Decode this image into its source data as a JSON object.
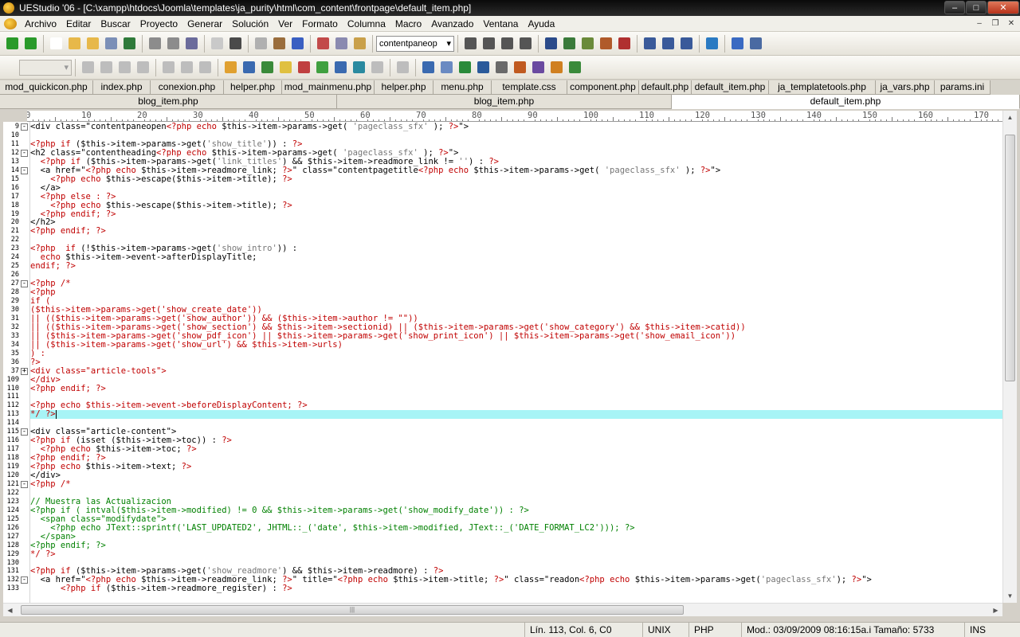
{
  "window": {
    "title": "UEStudio '06 - [C:\\xampp\\htdocs\\Joomla\\templates\\ja_purity\\html\\com_content\\frontpage\\default_item.php]"
  },
  "menu": [
    "Archivo",
    "Editar",
    "Buscar",
    "Proyecto",
    "Generar",
    "Solución",
    "Ver",
    "Formato",
    "Columna",
    "Macro",
    "Avanzado",
    "Ventana",
    "Ayuda"
  ],
  "toolbar": {
    "font_combo_value": "contentpaneop"
  },
  "tabs_row1": [
    "mod_quickicon.php",
    "index.php",
    "conexion.php",
    "helper.php",
    "mod_mainmenu.php",
    "helper.php",
    "menu.php",
    "template.css",
    "component.php",
    "default.php",
    "default_item.php",
    "ja_templatetools.php",
    "ja_vars.php",
    "params.ini"
  ],
  "tabs_row2": [
    "blog_item.php",
    "blog_item.php",
    "default_item.php"
  ],
  "ruler_labels": [
    "0",
    "10",
    "20",
    "30",
    "40",
    "50",
    "60",
    "70",
    "80",
    "90",
    "100",
    "110",
    "120",
    "130",
    "140",
    "150",
    "160",
    "170"
  ],
  "editor": {
    "lines": [
      {
        "num": "9",
        "fold": "-",
        "parts": [
          [
            "v",
            "<div class=\"contentpaneopen"
          ],
          [
            "k",
            "<?php echo "
          ],
          [
            "v",
            "$this->item->params->get( "
          ],
          [
            "s",
            "'pageclass_sfx'"
          ],
          [
            "v",
            " ); "
          ],
          [
            "k",
            "?>"
          ],
          [
            "v",
            "\">"
          ]
        ]
      },
      {
        "num": "10",
        "parts": []
      },
      {
        "num": "11",
        "parts": [
          [
            "k",
            "<?php if "
          ],
          [
            "v",
            "($this->item->params->get("
          ],
          [
            "s",
            "'show_title'"
          ],
          [
            "v",
            ")) : "
          ],
          [
            "k",
            "?>"
          ]
        ]
      },
      {
        "num": "12",
        "fold": "-",
        "parts": [
          [
            "v",
            "<h2 class=\"contentheading"
          ],
          [
            "k",
            "<?php echo "
          ],
          [
            "v",
            "$this->item->params->get( "
          ],
          [
            "s",
            "'pageclass_sfx'"
          ],
          [
            "v",
            " ); "
          ],
          [
            "k",
            "?>"
          ],
          [
            "v",
            "\">"
          ]
        ]
      },
      {
        "num": "13",
        "parts": [
          [
            "v",
            "  "
          ],
          [
            "k",
            "<?php if "
          ],
          [
            "v",
            "($this->item->params->get("
          ],
          [
            "s",
            "'link_titles'"
          ],
          [
            "v",
            ") && $this->item->readmore_link != "
          ],
          [
            "s",
            "''"
          ],
          [
            "v",
            ") : "
          ],
          [
            "k",
            "?>"
          ]
        ]
      },
      {
        "num": "14",
        "fold": "-",
        "parts": [
          [
            "v",
            "  <a href=\""
          ],
          [
            "k",
            "<?php echo "
          ],
          [
            "v",
            "$this->item->readmore_link; "
          ],
          [
            "k",
            "?>"
          ],
          [
            "v",
            "\" class=\"contentpagetitle"
          ],
          [
            "k",
            "<?php echo "
          ],
          [
            "v",
            "$this->item->params->get( "
          ],
          [
            "s",
            "'pageclass_sfx'"
          ],
          [
            "v",
            " ); "
          ],
          [
            "k",
            "?>"
          ],
          [
            "v",
            "\">"
          ]
        ]
      },
      {
        "num": "15",
        "parts": [
          [
            "v",
            "    "
          ],
          [
            "k",
            "<?php echo "
          ],
          [
            "v",
            "$this->escape($this->item->title); "
          ],
          [
            "k",
            "?>"
          ]
        ]
      },
      {
        "num": "16",
        "parts": [
          [
            "v",
            "  </a>"
          ]
        ]
      },
      {
        "num": "17",
        "parts": [
          [
            "v",
            "  "
          ],
          [
            "k",
            "<?php else : ?>"
          ]
        ]
      },
      {
        "num": "18",
        "parts": [
          [
            "v",
            "    "
          ],
          [
            "k",
            "<?php echo "
          ],
          [
            "v",
            "$this->escape($this->item->title); "
          ],
          [
            "k",
            "?>"
          ]
        ]
      },
      {
        "num": "19",
        "parts": [
          [
            "v",
            "  "
          ],
          [
            "k",
            "<?php endif; ?>"
          ]
        ]
      },
      {
        "num": "20",
        "parts": [
          [
            "v",
            "</h2>"
          ]
        ]
      },
      {
        "num": "21",
        "parts": [
          [
            "k",
            "<?php endif; ?>"
          ]
        ]
      },
      {
        "num": "22",
        "parts": []
      },
      {
        "num": "23",
        "parts": [
          [
            "k",
            "<?php  if "
          ],
          [
            "v",
            "(!$this->item->params->get("
          ],
          [
            "s",
            "'show_intro'"
          ],
          [
            "v",
            ")) :"
          ]
        ]
      },
      {
        "num": "24",
        "parts": [
          [
            "v",
            "  "
          ],
          [
            "k",
            "echo "
          ],
          [
            "v",
            "$this->item->event->afterDisplayTitle;"
          ]
        ]
      },
      {
        "num": "25",
        "parts": [
          [
            "k",
            "endif; ?>"
          ]
        ]
      },
      {
        "num": "26",
        "parts": []
      },
      {
        "num": "27",
        "fold": "-",
        "parts": [
          [
            "k",
            "<?php /*"
          ]
        ]
      },
      {
        "num": "28",
        "parts": [
          [
            "k",
            "<?php"
          ]
        ]
      },
      {
        "num": "29",
        "parts": [
          [
            "k",
            "if ("
          ]
        ]
      },
      {
        "num": "30",
        "parts": [
          [
            "k",
            "($this->item->params->get('show_create_date'))"
          ]
        ]
      },
      {
        "num": "31",
        "parts": [
          [
            "k",
            "|| (($this->item->params->get('show_author')) && ($this->item->author != \"\"))"
          ]
        ]
      },
      {
        "num": "32",
        "parts": [
          [
            "k",
            "|| (($this->item->params->get('show_section') && $this->item->sectionid) || ($this->item->params->get('show_category') && $this->item->catid))"
          ]
        ]
      },
      {
        "num": "33",
        "parts": [
          [
            "k",
            "|| ($this->item->params->get('show_pdf_icon') || $this->item->params->get('show_print_icon') || $this->item->params->get('show_email_icon'))"
          ]
        ]
      },
      {
        "num": "34",
        "parts": [
          [
            "k",
            "|| ($this->item->params->get('show_url') && $this->item->urls)"
          ]
        ]
      },
      {
        "num": "35",
        "parts": [
          [
            "k",
            ") :"
          ]
        ]
      },
      {
        "num": "36",
        "parts": [
          [
            "k",
            "?>"
          ]
        ]
      },
      {
        "num": "37",
        "fold": "+",
        "parts": [
          [
            "k",
            "<div class=\"article-tools\">"
          ]
        ]
      },
      {
        "num": "109",
        "parts": [
          [
            "k",
            "</div>"
          ]
        ]
      },
      {
        "num": "110",
        "parts": [
          [
            "k",
            "<?php endif; ?>"
          ]
        ]
      },
      {
        "num": "111",
        "parts": []
      },
      {
        "num": "112",
        "parts": [
          [
            "k",
            "<?php echo $this->item->event->beforeDisplayContent; ?>"
          ]
        ]
      },
      {
        "num": "113",
        "cur": true,
        "parts": [
          [
            "k",
            "*/ ?>"
          ]
        ]
      },
      {
        "num": "114",
        "parts": []
      },
      {
        "num": "115",
        "fold": "-",
        "parts": [
          [
            "v",
            "<div class=\"article-content\">"
          ]
        ]
      },
      {
        "num": "116",
        "parts": [
          [
            "k",
            "<?php if "
          ],
          [
            "v",
            "(isset ($this->item->toc)) : "
          ],
          [
            "k",
            "?>"
          ]
        ]
      },
      {
        "num": "117",
        "parts": [
          [
            "v",
            "  "
          ],
          [
            "k",
            "<?php echo "
          ],
          [
            "v",
            "$this->item->toc; "
          ],
          [
            "k",
            "?>"
          ]
        ]
      },
      {
        "num": "118",
        "parts": [
          [
            "k",
            "<?php endif; ?>"
          ]
        ]
      },
      {
        "num": "119",
        "parts": [
          [
            "k",
            "<?php echo "
          ],
          [
            "v",
            "$this->item->text; "
          ],
          [
            "k",
            "?>"
          ]
        ]
      },
      {
        "num": "120",
        "parts": [
          [
            "v",
            "</div>"
          ]
        ]
      },
      {
        "num": "121",
        "fold": "-",
        "parts": [
          [
            "k",
            "<?php /*"
          ]
        ]
      },
      {
        "num": "122",
        "parts": []
      },
      {
        "num": "123",
        "parts": [
          [
            "c",
            "// Muestra las Actualizacion"
          ]
        ]
      },
      {
        "num": "124",
        "parts": [
          [
            "c",
            "<?php if ( intval($this->item->modified) != 0 && $this->item->params->get('show_modify_date')) : ?>"
          ]
        ]
      },
      {
        "num": "125",
        "parts": [
          [
            "c",
            "  <span class=\"modifydate\">"
          ]
        ]
      },
      {
        "num": "126",
        "parts": [
          [
            "c",
            "    <?php echo JText::sprintf('LAST_UPDATED2', JHTML::_('date', $this->item->modified, JText::_('DATE_FORMAT_LC2'))); ?>"
          ]
        ]
      },
      {
        "num": "127",
        "parts": [
          [
            "c",
            "  </span>"
          ]
        ]
      },
      {
        "num": "128",
        "parts": [
          [
            "c",
            "<?php endif; ?>"
          ]
        ]
      },
      {
        "num": "129",
        "parts": [
          [
            "k",
            "*/ ?>"
          ]
        ]
      },
      {
        "num": "130",
        "parts": []
      },
      {
        "num": "131",
        "parts": [
          [
            "k",
            "<?php if "
          ],
          [
            "v",
            "($this->item->params->get("
          ],
          [
            "s",
            "'show_readmore'"
          ],
          [
            "v",
            ") && $this->item->readmore) : "
          ],
          [
            "k",
            "?>"
          ]
        ]
      },
      {
        "num": "132",
        "fold": "-",
        "parts": [
          [
            "v",
            "  <a href=\""
          ],
          [
            "k",
            "<?php echo "
          ],
          [
            "v",
            "$this->item->readmore_link; "
          ],
          [
            "k",
            "?>"
          ],
          [
            "v",
            "\" title=\""
          ],
          [
            "k",
            "<?php echo "
          ],
          [
            "v",
            "$this->item->title; "
          ],
          [
            "k",
            "?>"
          ],
          [
            "v",
            "\" class=\"readon"
          ],
          [
            "k",
            "<?php echo "
          ],
          [
            "v",
            "$this->item->params->get("
          ],
          [
            "s",
            "'pageclass_sfx'"
          ],
          [
            "v",
            "); "
          ],
          [
            "k",
            "?>"
          ],
          [
            "v",
            "\">"
          ]
        ]
      },
      {
        "num": "133",
        "parts": [
          [
            "v",
            "      "
          ],
          [
            "k",
            "<?php if "
          ],
          [
            "v",
            "($this->item->readmore_register) : "
          ],
          [
            "k",
            "?>"
          ]
        ]
      }
    ]
  },
  "status": {
    "position": "Lín. 113, Col. 6, C0",
    "line_ending": "UNIX",
    "syntax": "PHP",
    "modified": "Mod.: 03/09/2009 08:16:15a.i Tamaño: 5733",
    "mode": "INS"
  },
  "colors": {
    "keyword": "#c00000",
    "comment": "#008000",
    "string": "#767676",
    "current_line": "#a7f4f6"
  }
}
